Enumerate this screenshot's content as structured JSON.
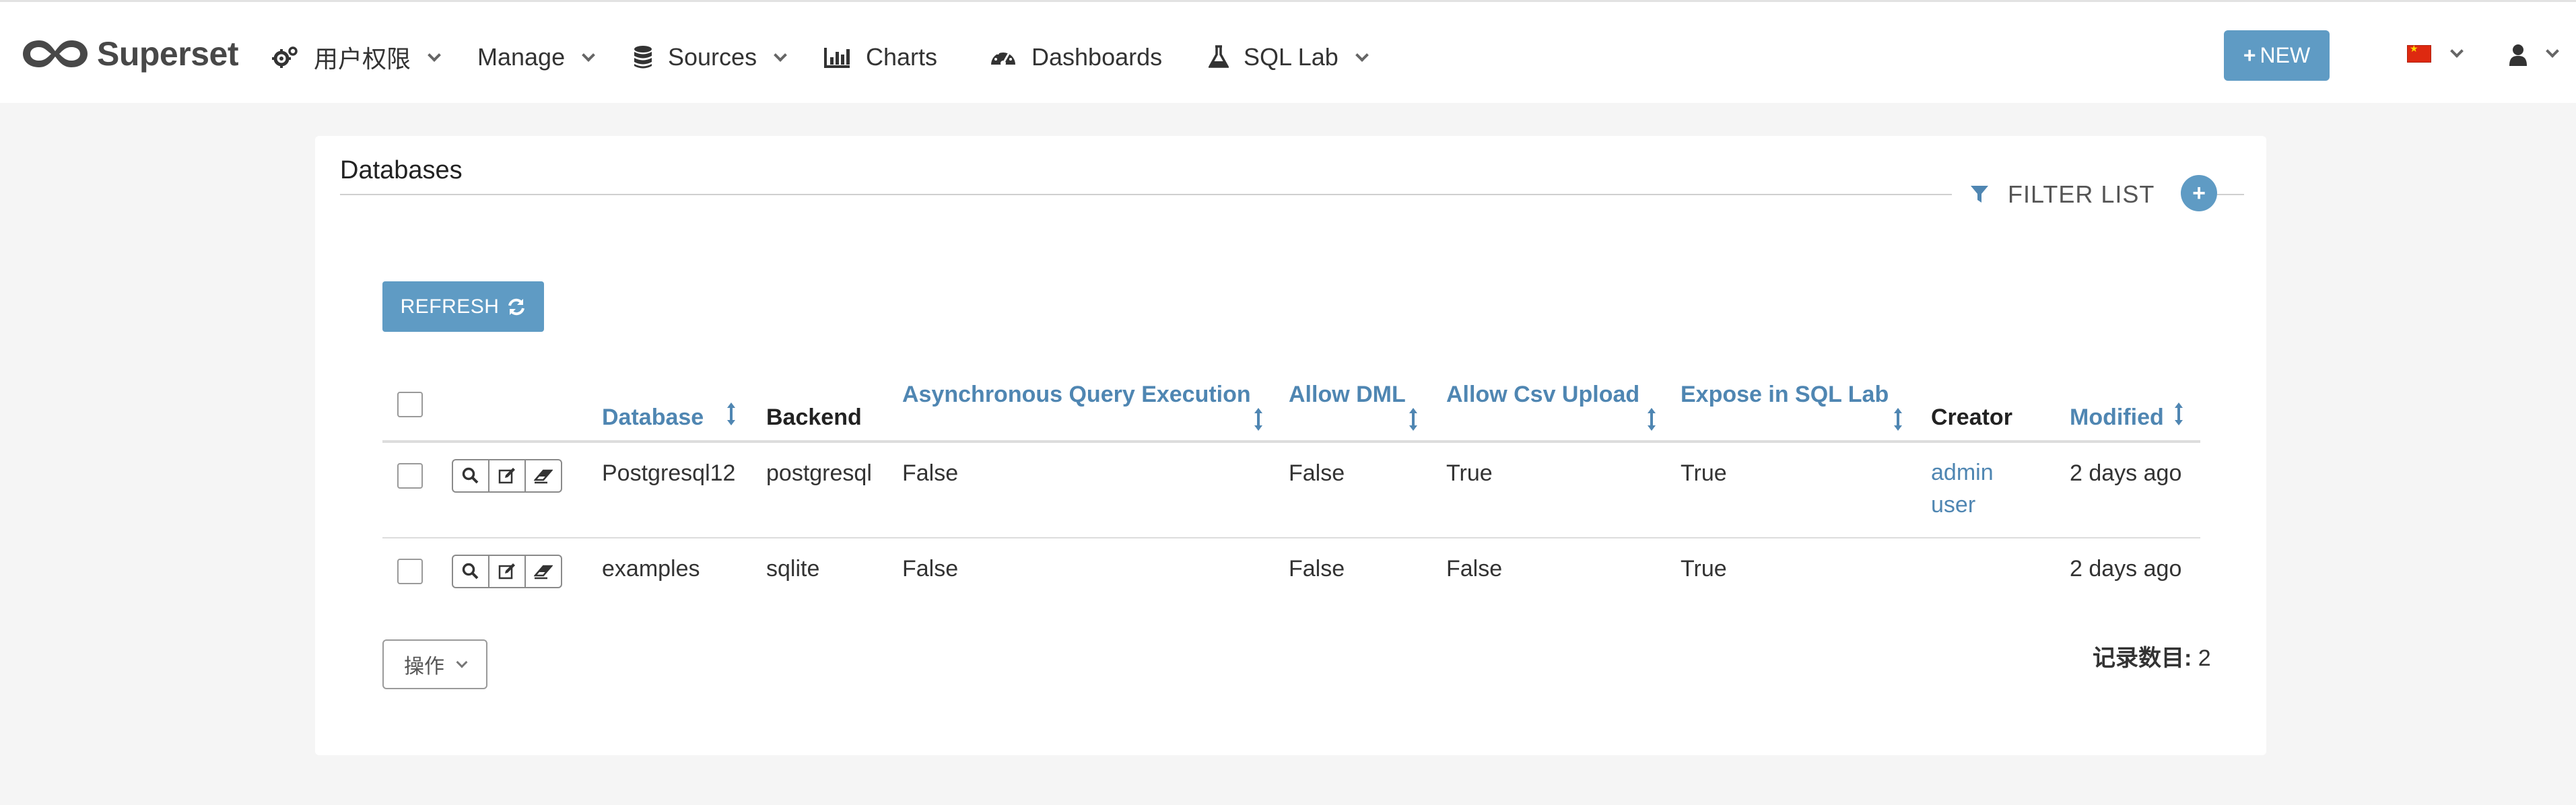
{
  "app": {
    "brand": "Superset",
    "accent_color": "#5f9bc4",
    "link_color": "#4f86b2"
  },
  "nav": {
    "security": {
      "label": "用户权限",
      "icon": "cogs-icon"
    },
    "manage": {
      "label": "Manage"
    },
    "sources": {
      "label": "Sources",
      "icon": "database-icon"
    },
    "charts": {
      "label": "Charts",
      "icon": "bar-chart-icon"
    },
    "dashboards": {
      "label": "Dashboards",
      "icon": "dashboard-icon"
    },
    "sqllab": {
      "label": "SQL Lab",
      "icon": "flask-icon"
    },
    "new_button": "NEW",
    "language_flag": "zh-flag",
    "user_icon": "user-icon"
  },
  "panel": {
    "title": "Databases",
    "filter_list": "FILTER LIST",
    "refresh": "REFRESH"
  },
  "table": {
    "columns": {
      "database": "Database",
      "backend": "Backend",
      "async": "Asynchronous Query Execution",
      "allow_dml": "Allow DML",
      "allow_csv": "Allow Csv Upload",
      "expose_sql": "Expose in SQL Lab",
      "creator": "Creator",
      "modified": "Modified"
    },
    "rows": [
      {
        "database": "Postgresql12",
        "backend": "postgresql",
        "async": "False",
        "allow_dml": "False",
        "allow_csv": "True",
        "expose_sql": "True",
        "creator_line1": "admin",
        "creator_line2": "user",
        "modified": "2 days ago"
      },
      {
        "database": "examples",
        "backend": "sqlite",
        "async": "False",
        "allow_dml": "False",
        "allow_csv": "False",
        "expose_sql": "True",
        "creator_line1": "",
        "creator_line2": "",
        "modified": "2 days ago"
      }
    ]
  },
  "footer": {
    "actions_button": "操作",
    "record_label": "记录数目:",
    "record_count": "2"
  }
}
